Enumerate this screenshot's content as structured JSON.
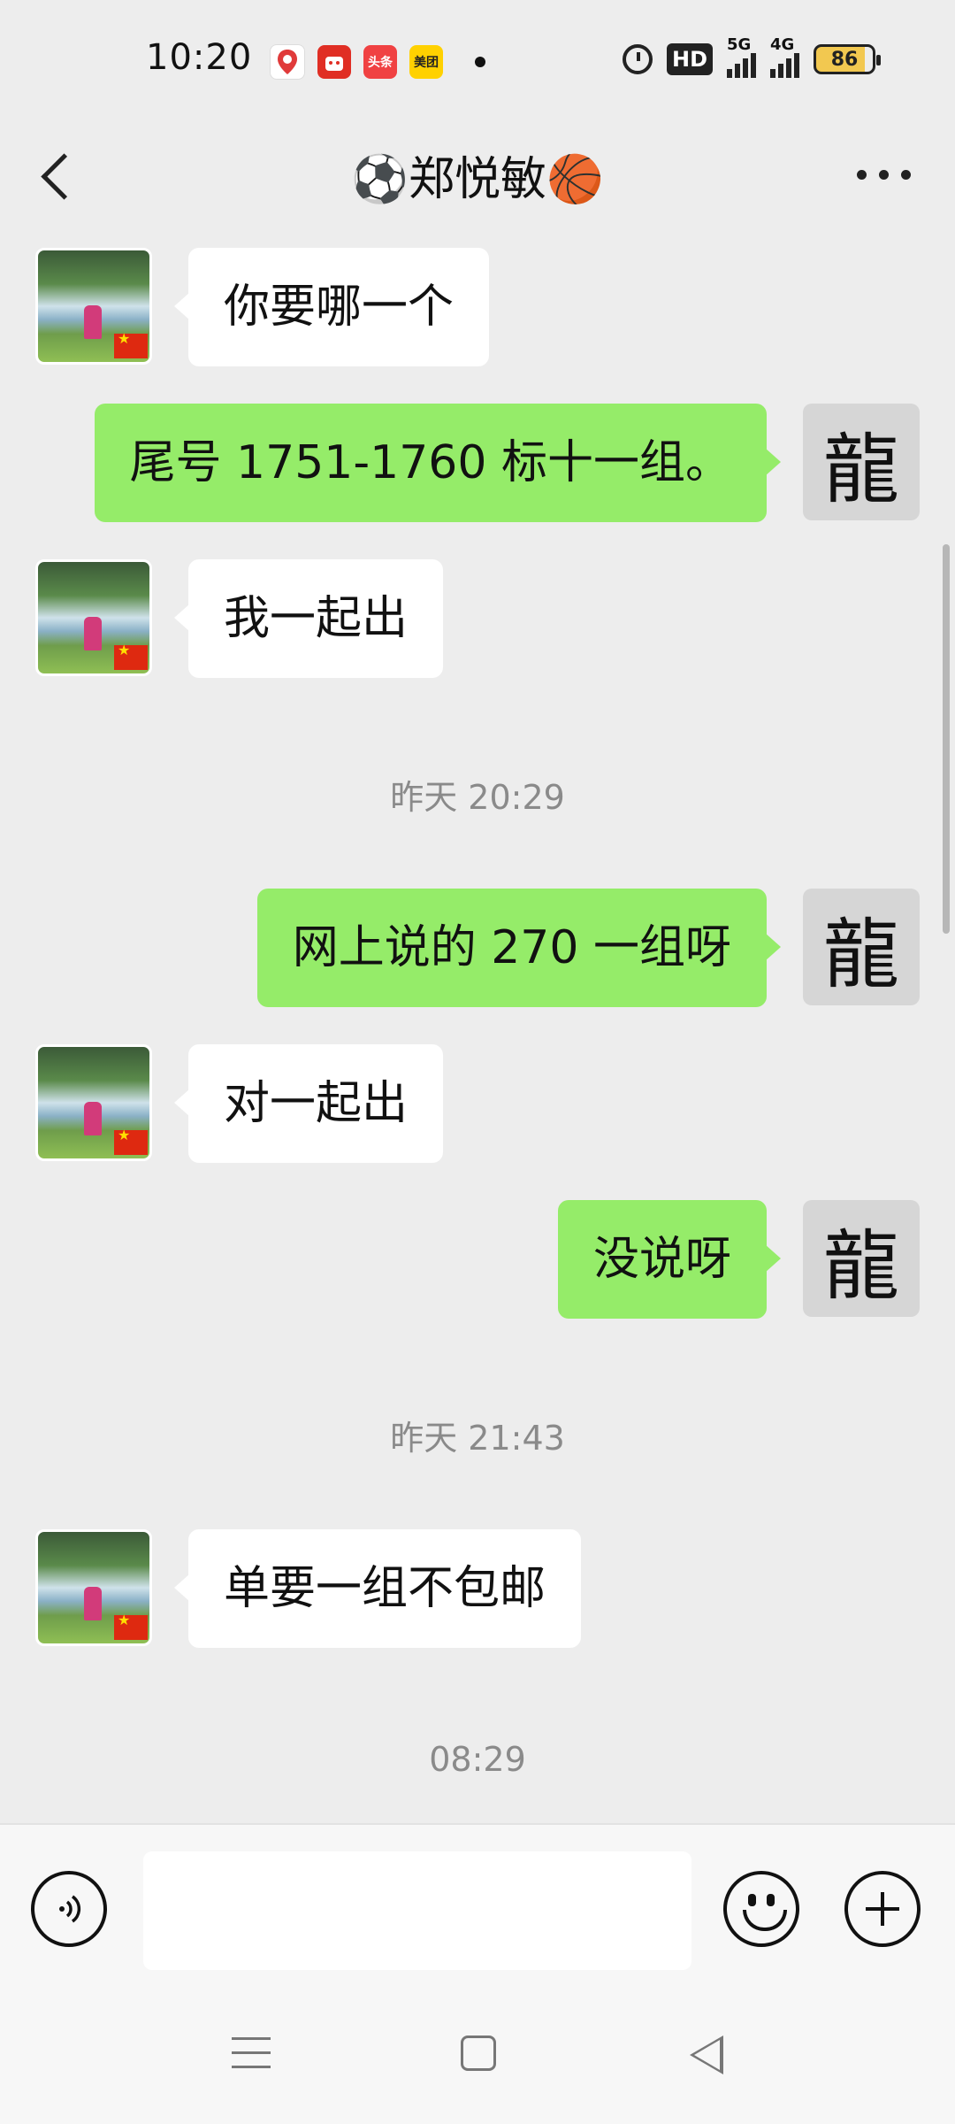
{
  "status_bar": {
    "time": "10:20",
    "app_icons": [
      {
        "name": "baidu-maps-icon",
        "color": "#ffffff",
        "text": "du"
      },
      {
        "name": "pinduoduo-icon",
        "color": "#e02e24",
        "text": ""
      },
      {
        "name": "toutiao-icon",
        "color": "#f04142",
        "text": "头条"
      },
      {
        "name": "meituan-icon",
        "color": "#ffd100",
        "text": "美团"
      }
    ],
    "hd": "HD",
    "network_5g": "5G",
    "network_4g": "4G",
    "battery": "86"
  },
  "header": {
    "title": "⚽郑悦敏🏀"
  },
  "messages": [
    {
      "type": "in",
      "text": "你要哪一个"
    },
    {
      "type": "out",
      "text": "尾号 1751-1760 标十一组。"
    },
    {
      "type": "in",
      "text": "我一起出"
    },
    {
      "type": "timestamp",
      "text": "昨天 20:29"
    },
    {
      "type": "out",
      "text": "网上说的 270 一组呀"
    },
    {
      "type": "in",
      "text": "对一起出"
    },
    {
      "type": "out",
      "text": "没说呀"
    },
    {
      "type": "timestamp",
      "text": "昨天 21:43"
    },
    {
      "type": "in",
      "text": "单要一组不包邮"
    },
    {
      "type": "timestamp",
      "text": "08:29"
    }
  ],
  "self_avatar_glyph": "龍",
  "colors": {
    "background": "#ededed",
    "incoming_bubble": "#ffffff",
    "outgoing_bubble": "#95ec69"
  }
}
